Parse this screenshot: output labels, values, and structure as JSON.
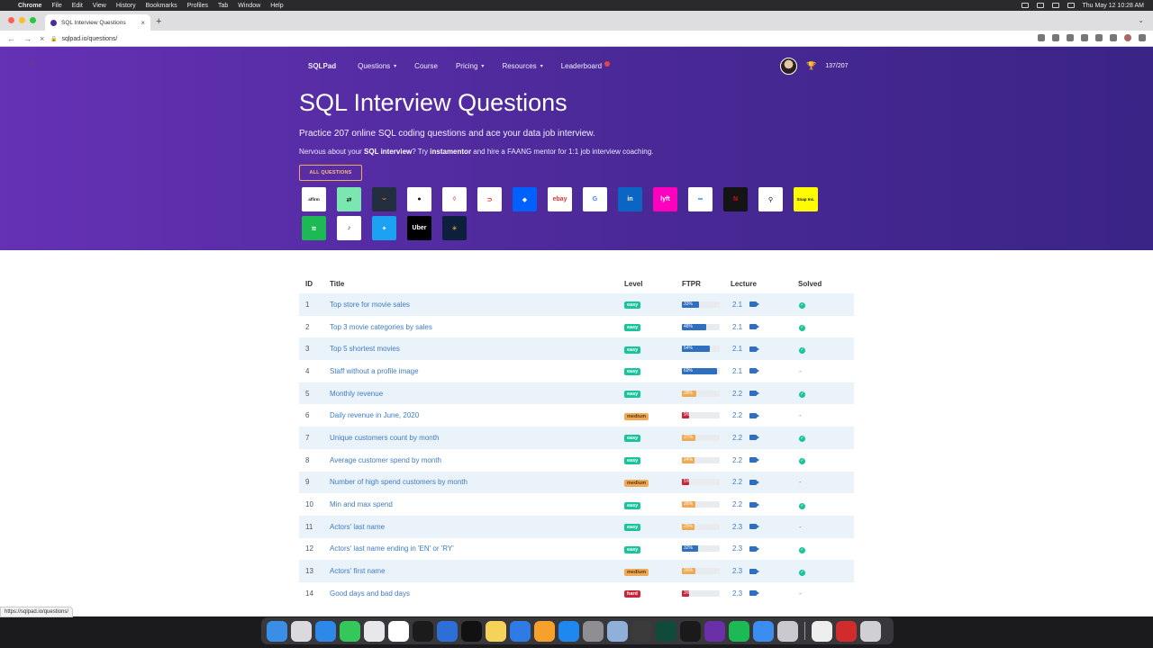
{
  "menubar": {
    "app": "Chrome",
    "items": [
      "File",
      "Edit",
      "View",
      "History",
      "Bookmarks",
      "Profiles",
      "Tab",
      "Window",
      "Help"
    ],
    "clock": "Thu May 12  10:28 AM"
  },
  "browser": {
    "tab_title": "SQL Interview Questions",
    "url": "sqlpad.io/questions/",
    "status_url": "https://sqlpad.io/questions/"
  },
  "nav": {
    "brand": "SQLPad",
    "items": [
      {
        "label": "Questions",
        "caret": true
      },
      {
        "label": "Course",
        "caret": false
      },
      {
        "label": "Pricing",
        "caret": true
      },
      {
        "label": "Resources",
        "caret": true
      },
      {
        "label": "Leaderboard",
        "caret": false
      }
    ],
    "progress": "137/207"
  },
  "hero": {
    "title": "SQL Interview Questions",
    "subtitle": "Practice 207 online SQL coding questions and ace your data job interview.",
    "note_prefix": "Nervous about your ",
    "note_bold1": "SQL interview",
    "note_mid": "? Try ",
    "note_bold2": "instamentor",
    "note_suffix": " and hire a FAANG mentor for 1:1 job interview coaching.",
    "button": "ALL QUESTIONS"
  },
  "companies": [
    {
      "name": "affirm-logo",
      "text": "affirm",
      "bg": "#ffffff",
      "fg": "#111111"
    },
    {
      "name": "postmates-logo",
      "text": "⇄",
      "bg": "#7ce6b0",
      "fg": "#111111"
    },
    {
      "name": "amazon-logo",
      "text": "⌣",
      "bg": "#232f3e",
      "fg": "#ff9900"
    },
    {
      "name": "apple-logo",
      "text": "●",
      "bg": "#ffffff",
      "fg": "#111111"
    },
    {
      "name": "airbnb-logo",
      "text": "◊",
      "bg": "#ffffff",
      "fg": "#ff5a5f"
    },
    {
      "name": "doordash-logo",
      "text": "⊃",
      "bg": "#ffffff",
      "fg": "#eb1700"
    },
    {
      "name": "dropbox-logo",
      "text": "◆",
      "bg": "#0061fe",
      "fg": "#ffffff"
    },
    {
      "name": "ebay-logo",
      "text": "ebay",
      "bg": "#ffffff",
      "fg": "#e53238"
    },
    {
      "name": "google-logo",
      "text": "G",
      "bg": "#ffffff",
      "fg": "#4285f4"
    },
    {
      "name": "linkedin-logo",
      "text": "in",
      "bg": "#0a66c2",
      "fg": "#ffffff"
    },
    {
      "name": "lyft-logo",
      "text": "lyft",
      "bg": "#ff00bf",
      "fg": "#ffffff"
    },
    {
      "name": "meta-logo",
      "text": "∞",
      "bg": "#ffffff",
      "fg": "#0668e1"
    },
    {
      "name": "netflix-logo",
      "text": "N",
      "bg": "#141414",
      "fg": "#e50914"
    },
    {
      "name": "robinhood-logo",
      "text": "⚲",
      "bg": "#ffffff",
      "fg": "#111111"
    },
    {
      "name": "snap-logo",
      "text": "Snap Inc.",
      "bg": "#fffc00",
      "fg": "#111111"
    },
    {
      "name": "spotify-logo",
      "text": "≋",
      "bg": "#1db954",
      "fg": "#ffffff"
    },
    {
      "name": "tiktok-logo",
      "text": "♪",
      "bg": "#ffffff",
      "fg": "#111111"
    },
    {
      "name": "twitter-logo",
      "text": "✦",
      "bg": "#1da1f2",
      "fg": "#ffffff"
    },
    {
      "name": "uber-logo",
      "text": "Uber",
      "bg": "#000000",
      "fg": "#ffffff"
    },
    {
      "name": "walmart-logo",
      "text": "✳",
      "bg": "#0e1f3d",
      "fg": "#ffc220"
    }
  ],
  "table": {
    "headers": [
      "ID",
      "Title",
      "Level",
      "FTPR",
      "Lecture",
      "Solved"
    ],
    "colors": {
      "ftpr_blue": "#2f6fc0",
      "ftpr_orange": "#f0a955",
      "ftpr_red": "#c9263a"
    },
    "rows": [
      {
        "id": "1",
        "title": "Top store for movie sales",
        "level": "easy",
        "ftpr": 33,
        "ftpr_label": "33%",
        "ftpr_color": "#2f6fc0",
        "lecture": "2.1",
        "solved": true
      },
      {
        "id": "2",
        "title": "Top 3 movie categories by sales",
        "level": "easy",
        "ftpr": 48,
        "ftpr_label": "48%",
        "ftpr_color": "#2f6fc0",
        "lecture": "2.1",
        "solved": true
      },
      {
        "id": "3",
        "title": "Top 5 shortest movies",
        "level": "easy",
        "ftpr": 54,
        "ftpr_label": "54%",
        "ftpr_color": "#2f6fc0",
        "lecture": "2.1",
        "solved": true
      },
      {
        "id": "4",
        "title": "Staff without a profile image",
        "level": "easy",
        "ftpr": 69,
        "ftpr_label": "69%",
        "ftpr_color": "#2f6fc0",
        "lecture": "2.1",
        "solved": false
      },
      {
        "id": "5",
        "title": "Monthly revenue",
        "level": "easy",
        "ftpr": 29,
        "ftpr_label": "29%",
        "ftpr_color": "#f0a955",
        "lecture": "2.2",
        "solved": true
      },
      {
        "id": "6",
        "title": "Daily revenue in June, 2020",
        "level": "medium",
        "ftpr": 9,
        "ftpr_label": "9%",
        "ftpr_color": "#c9263a",
        "lecture": "2.2",
        "solved": false
      },
      {
        "id": "7",
        "title": "Unique customers count by month",
        "level": "easy",
        "ftpr": 27,
        "ftpr_label": "27%",
        "ftpr_color": "#f0a955",
        "lecture": "2.2",
        "solved": true
      },
      {
        "id": "8",
        "title": "Average customer spend by month",
        "level": "easy",
        "ftpr": 24,
        "ftpr_label": "24%",
        "ftpr_color": "#f0a955",
        "lecture": "2.2",
        "solved": true
      },
      {
        "id": "9",
        "title": "Number of high spend customers by month",
        "level": "medium",
        "ftpr": 5,
        "ftpr_label": "5%",
        "ftpr_color": "#c9263a",
        "lecture": "2.2",
        "solved": false
      },
      {
        "id": "10",
        "title": "Min and max spend",
        "level": "easy",
        "ftpr": 26,
        "ftpr_label": "26%",
        "ftpr_color": "#f0a955",
        "lecture": "2.2",
        "solved": true
      },
      {
        "id": "11",
        "title": "Actors' last name",
        "level": "easy",
        "ftpr": 25,
        "ftpr_label": "25%",
        "ftpr_color": "#f0a955",
        "lecture": "2.3",
        "solved": false
      },
      {
        "id": "12",
        "title": "Actors' last name ending in 'EN' or 'RY'",
        "level": "easy",
        "ftpr": 32,
        "ftpr_label": "32%",
        "ftpr_color": "#2f6fc0",
        "lecture": "2.3",
        "solved": true
      },
      {
        "id": "13",
        "title": "Actors' first name",
        "level": "medium",
        "ftpr": 26,
        "ftpr_label": "26%",
        "ftpr_color": "#f0a955",
        "lecture": "2.3",
        "solved": true
      },
      {
        "id": "14",
        "title": "Good days and bad days",
        "level": "hard",
        "ftpr": 3,
        "ftpr_label": "3%",
        "ftpr_color": "#c9263a",
        "lecture": "2.3",
        "solved": false
      }
    ]
  },
  "dock_apps": [
    {
      "name": "finder-icon",
      "bg": "#3a8ee6"
    },
    {
      "name": "launchpad-icon",
      "bg": "#d9d9de"
    },
    {
      "name": "safari-icon",
      "bg": "#2e88e8"
    },
    {
      "name": "messages-icon",
      "bg": "#34c759"
    },
    {
      "name": "chrome-icon",
      "bg": "#e8e8ea"
    },
    {
      "name": "calendar-icon",
      "bg": "#ffffff"
    },
    {
      "name": "pycharm-icon",
      "bg": "#1b1b1b"
    },
    {
      "name": "xcode-icon",
      "bg": "#2d6fd6"
    },
    {
      "name": "terminal-icon",
      "bg": "#111111"
    },
    {
      "name": "notes-icon",
      "bg": "#f5d35a"
    },
    {
      "name": "keynote-icon",
      "bg": "#2f7be5"
    },
    {
      "name": "pages-icon",
      "bg": "#f7a12d"
    },
    {
      "name": "app-store-icon",
      "bg": "#1e88f0"
    },
    {
      "name": "system-prefs-icon",
      "bg": "#8e8e93"
    },
    {
      "name": "r-icon",
      "bg": "#8fb0d9"
    },
    {
      "name": "sublime-icon",
      "bg": "#3b3b3b"
    },
    {
      "name": "sql-icon",
      "bg": "#0f4a3a"
    },
    {
      "name": "iterm-icon",
      "bg": "#1a1a1a"
    },
    {
      "name": "visual-studio-icon",
      "bg": "#6b2fa8"
    },
    {
      "name": "spotify-icon",
      "bg": "#1db954"
    },
    {
      "name": "mail-icon",
      "bg": "#3b8ef0"
    },
    {
      "name": "photo-icon",
      "bg": "#c9c9cf"
    },
    {
      "name": "documents-icon",
      "bg": "#eeeeee"
    },
    {
      "name": "adobe-icon",
      "bg": "#d22b2b"
    },
    {
      "name": "trash-icon",
      "bg": "#cfcfd4"
    }
  ]
}
